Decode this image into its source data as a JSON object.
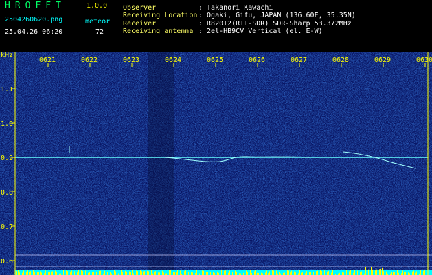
{
  "header": {
    "app_name": "HROFFT",
    "version": "1.0.0",
    "filename": "2504260620.png",
    "timestamp": "25.04.26 06:20",
    "mode_label": "meteor",
    "count": "72",
    "info": [
      {
        "label": "Observer",
        "value": ": Takanori Kawachi"
      },
      {
        "label": "Receiving Location",
        "value": ": Ogaki, Gifu, JAPAN (136.60E, 35.35N)"
      },
      {
        "label": "Receiver",
        "value": ": R820T2(RTL-SDR) SDR-Sharp 53.372MHz"
      },
      {
        "label": "Receiving antenna",
        "value": ": 2el-HB9CV Vertical (el. E-W)"
      }
    ]
  },
  "spectrogram": {
    "unit": "kHz",
    "time_ticks": [
      "0621",
      "0622",
      "0623",
      "0624",
      "0625",
      "0626",
      "0627",
      "0628",
      "0629",
      "0630"
    ],
    "freq_ticks": [
      "1.1",
      "1.0",
      "0.9",
      "0.8",
      "0.7",
      "0.6"
    ],
    "colors": {
      "background": "#0a1a6e",
      "carrier": "#66ffff",
      "axis": "#ffff00",
      "baseline": "#00ffff",
      "bars": "#ffff00"
    }
  }
}
